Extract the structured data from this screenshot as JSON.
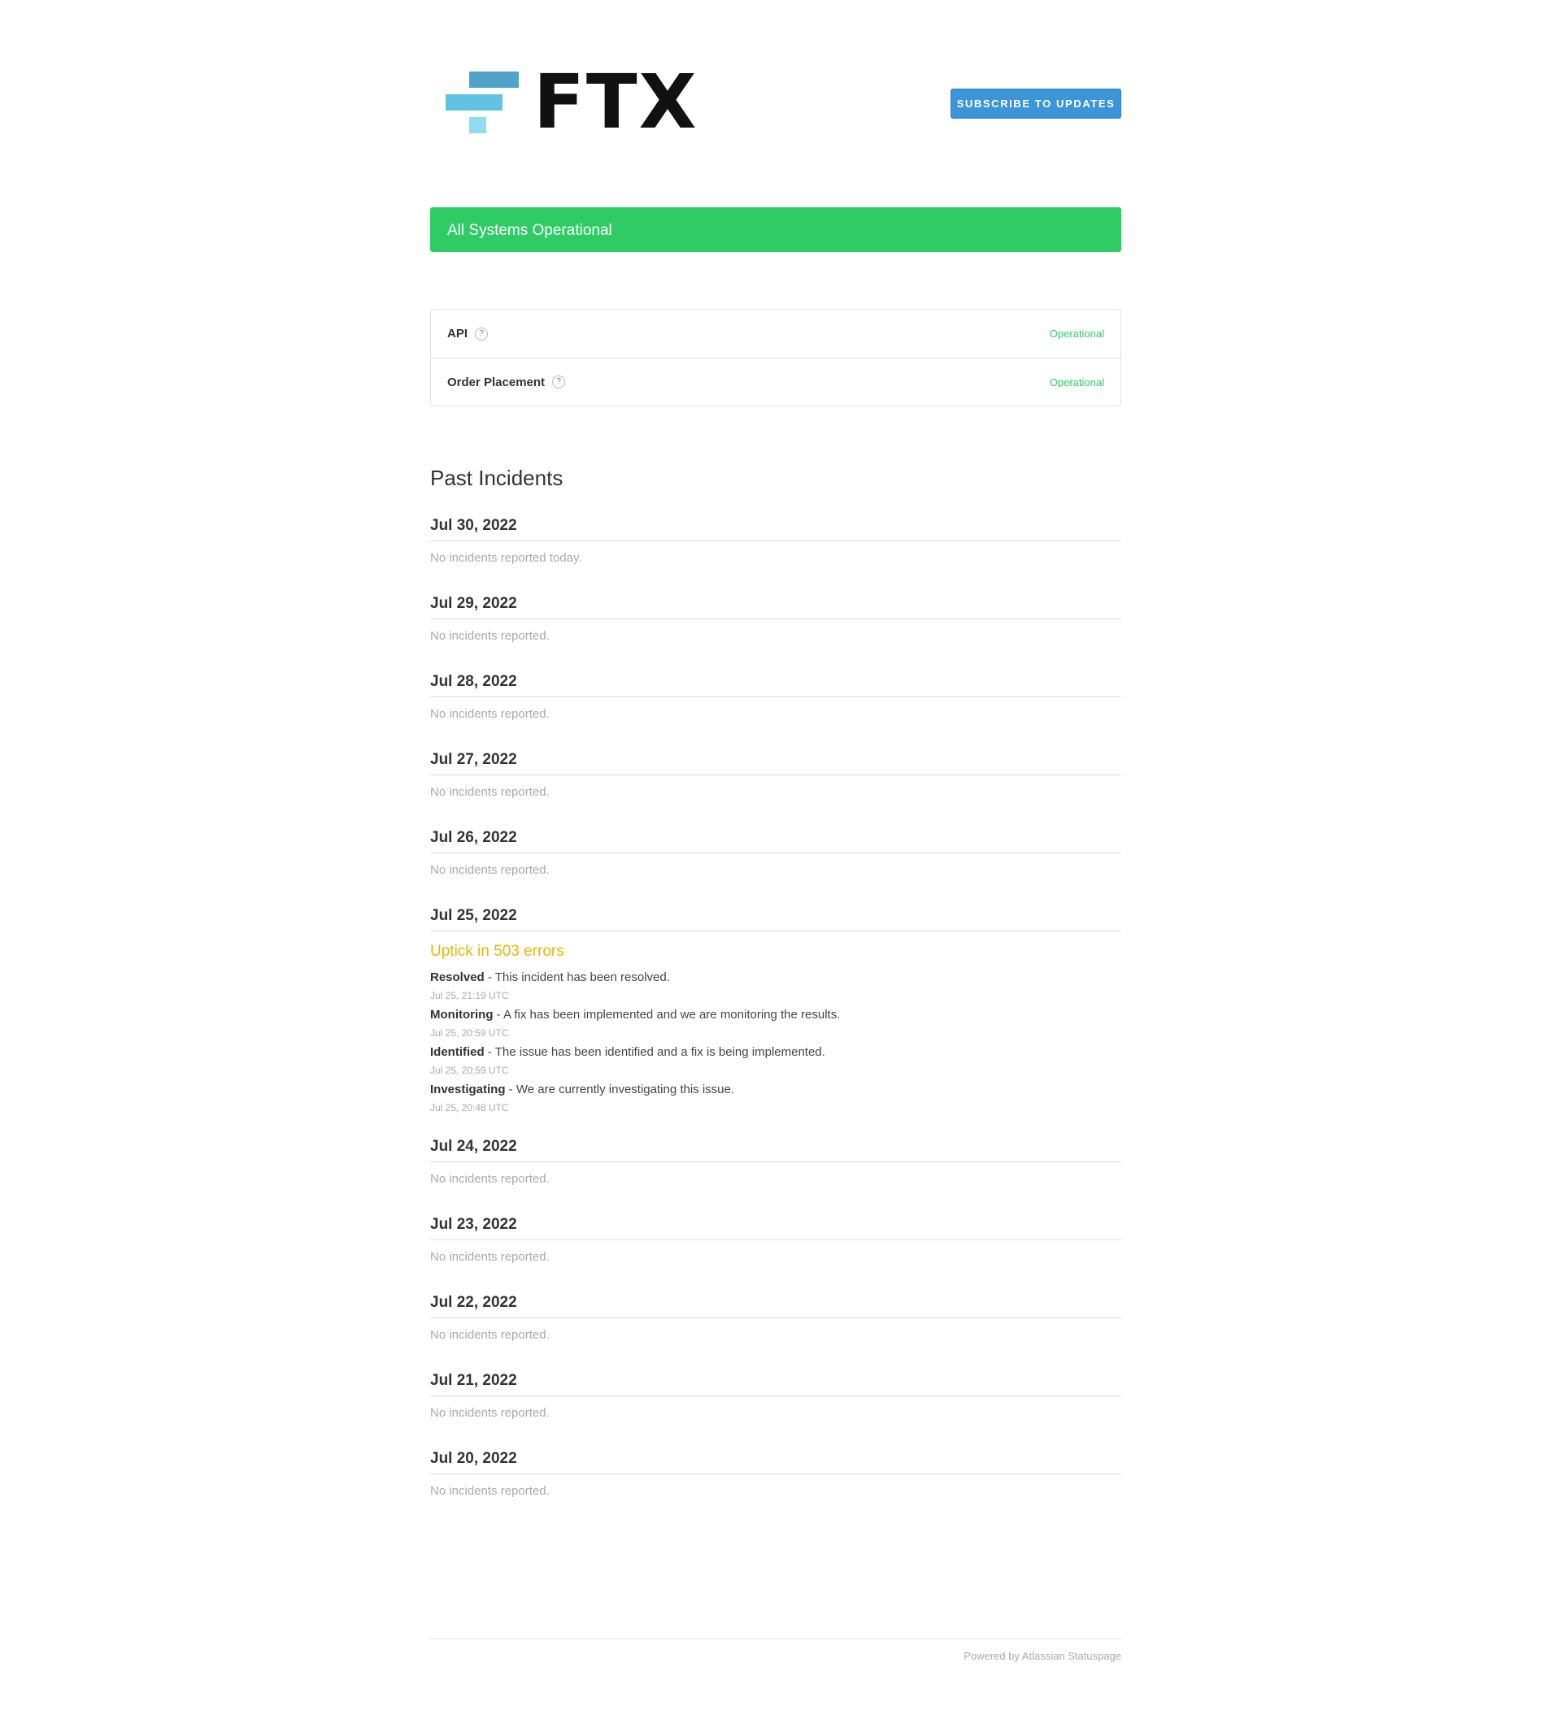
{
  "header": {
    "logo_text": "FTX",
    "subscribe_label": "SUBSCRIBE TO UPDATES"
  },
  "status_banner": {
    "text": "All Systems Operational",
    "color": "#2fcc66"
  },
  "components": [
    {
      "name": "API",
      "status": "Operational"
    },
    {
      "name": "Order Placement",
      "status": "Operational"
    }
  ],
  "past_incidents": {
    "title": "Past Incidents",
    "days": [
      {
        "date": "Jul 30, 2022",
        "empty": "No incidents reported today."
      },
      {
        "date": "Jul 29, 2022",
        "empty": "No incidents reported."
      },
      {
        "date": "Jul 28, 2022",
        "empty": "No incidents reported."
      },
      {
        "date": "Jul 27, 2022",
        "empty": "No incidents reported."
      },
      {
        "date": "Jul 26, 2022",
        "empty": "No incidents reported."
      },
      {
        "date": "Jul 25, 2022",
        "incident": {
          "title": "Uptick in 503 errors",
          "updates": [
            {
              "status": "Resolved",
              "message": " - This incident has been resolved.",
              "time": "Jul 25, 21:19 UTC"
            },
            {
              "status": "Monitoring",
              "message": " - A fix has been implemented and we are monitoring the results.",
              "time": "Jul 25, 20:59 UTC"
            },
            {
              "status": "Identified",
              "message": " - The issue has been identified and a fix is being implemented.",
              "time": "Jul 25, 20:59 UTC"
            },
            {
              "status": "Investigating",
              "message": " - We are currently investigating this issue.",
              "time": "Jul 25, 20:48 UTC"
            }
          ]
        }
      },
      {
        "date": "Jul 24, 2022",
        "empty": "No incidents reported."
      },
      {
        "date": "Jul 23, 2022",
        "empty": "No incidents reported."
      },
      {
        "date": "Jul 22, 2022",
        "empty": "No incidents reported."
      },
      {
        "date": "Jul 21, 2022",
        "empty": "No incidents reported."
      },
      {
        "date": "Jul 20, 2022",
        "empty": "No incidents reported."
      }
    ]
  },
  "footer": {
    "text": "Powered by Atlassian Statuspage"
  }
}
